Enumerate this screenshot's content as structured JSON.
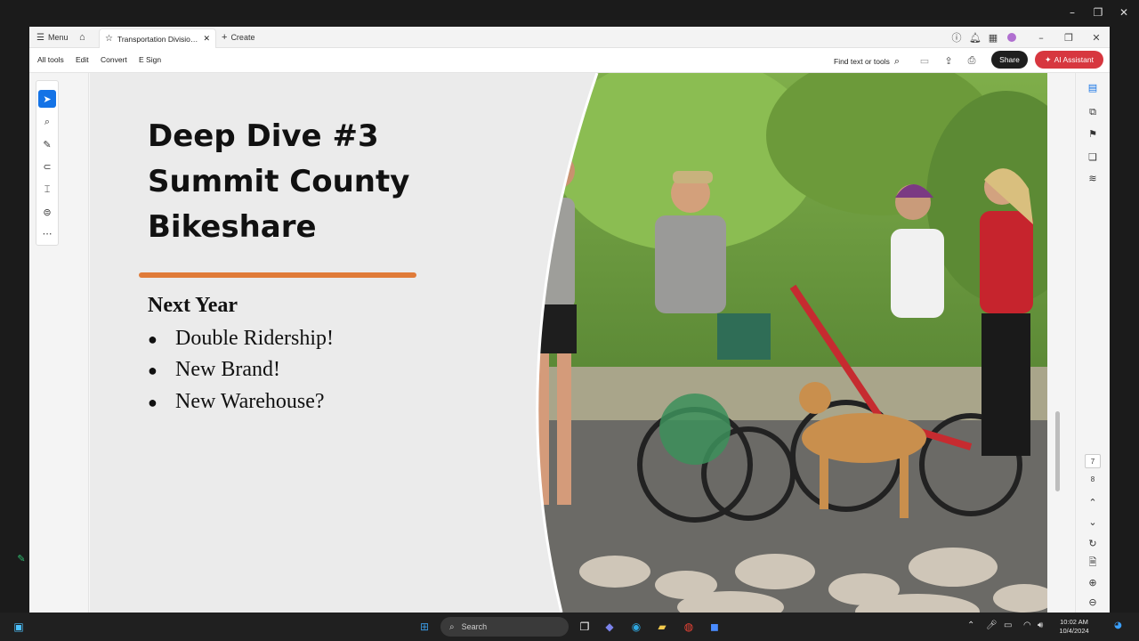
{
  "app": {
    "menu_label": "Menu",
    "tab_title": "Transportation Division...",
    "create_label": "Create"
  },
  "toolbar": {
    "all_tools": "All tools",
    "edit": "Edit",
    "convert": "Convert",
    "esign": "E Sign",
    "find": "Find text or tools",
    "share": "Share",
    "ai_assistant": "AI Assistant"
  },
  "slide": {
    "title_lines": [
      "Deep Dive #3",
      "Summit County",
      "Bikeshare"
    ],
    "heading": "Next Year",
    "bullets": [
      "Double Ridership!",
      "New Brand!",
      "New Warehouse?"
    ]
  },
  "page_nav": {
    "current_page": "7",
    "total_pages": "8"
  },
  "taskbar": {
    "search_placeholder": "Search",
    "time": "10:02 AM",
    "date": "10/4/2024"
  },
  "colors": {
    "accent_orange": "#e07b39",
    "share_button": "#1e1e1e",
    "ai_button": "#d7373f",
    "select_tool": "#1473e6"
  },
  "icons": [
    "menu-icon",
    "home-icon",
    "star-icon",
    "close-icon",
    "plus-icon",
    "help-icon",
    "bell-icon",
    "apps-icon",
    "profile-icon",
    "minimize-icon",
    "restore-icon",
    "search-icon",
    "save-icon",
    "upload-icon",
    "print-icon",
    "select-tool-icon",
    "zoom-tool-icon",
    "pen-icon",
    "lasso-icon",
    "text-select-icon",
    "stamp-icon",
    "more-icon"
  ]
}
